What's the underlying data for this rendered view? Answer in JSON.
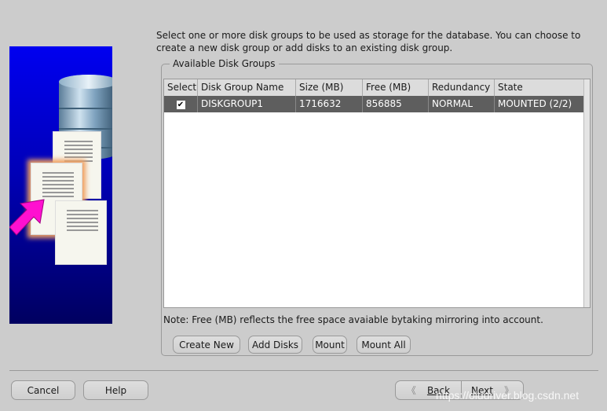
{
  "description": "Select one or more disk groups to be used as storage for the database. You can choose to create a new disk group or add disks to an existing disk group.",
  "group_title": "Available Disk Groups",
  "table": {
    "columns": [
      "Select",
      "Disk Group Name",
      "Size (MB)",
      "Free (MB)",
      "Redundancy",
      "State"
    ],
    "rows": [
      {
        "checked": true,
        "name": "DISKGROUP1",
        "size": "1716632",
        "free": "856885",
        "redundancy": "NORMAL",
        "state": "MOUNTED (2/2)"
      }
    ],
    "selected_row_color": "#5e5e5e"
  },
  "note": "Note: Free (MB) reflects the free space avaiable bytaking mirroring into account.",
  "group_buttons": {
    "create_new": "Create New",
    "add_disks": "Add Disks",
    "mount": "Mount",
    "mount_all": "Mount All"
  },
  "footer": {
    "cancel": "Cancel",
    "help": "Help",
    "back": "Back",
    "next": "Next"
  },
  "watermark": "https://olddriver.blog.csdn.net",
  "icons": {
    "check": "checkmark-icon",
    "back": "chevron-left-icon",
    "next": "chevron-right-icon"
  }
}
